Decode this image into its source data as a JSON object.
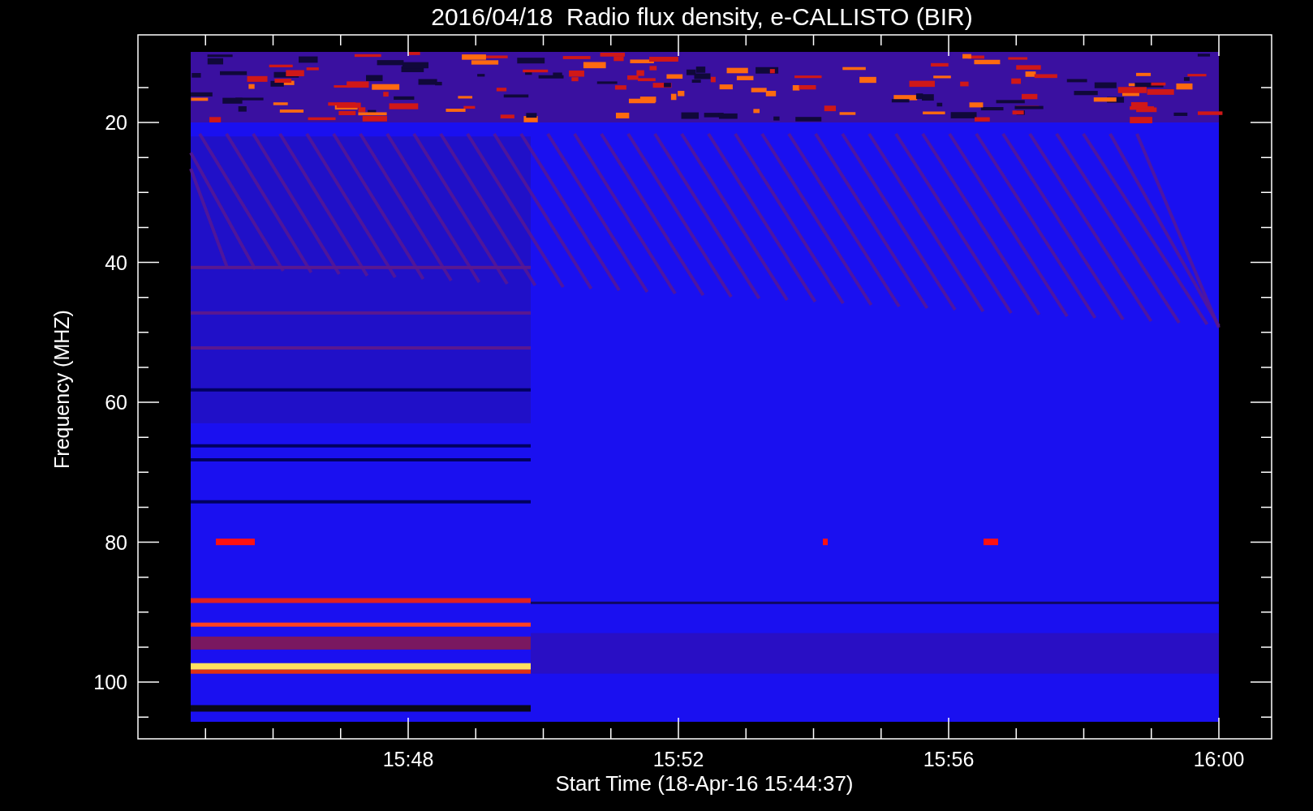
{
  "title": "2016/04/18  Radio flux density, e-CALLISTO (BIR)",
  "y_axis": {
    "label": "Frequency (MHZ)",
    "ticks": [
      "20",
      "40",
      "60",
      "80",
      "100"
    ]
  },
  "x_axis": {
    "label": "Start Time (18-Apr-16 15:44:37)",
    "ticks": [
      "15:48",
      "15:52",
      "15:56",
      "16:00"
    ]
  }
}
